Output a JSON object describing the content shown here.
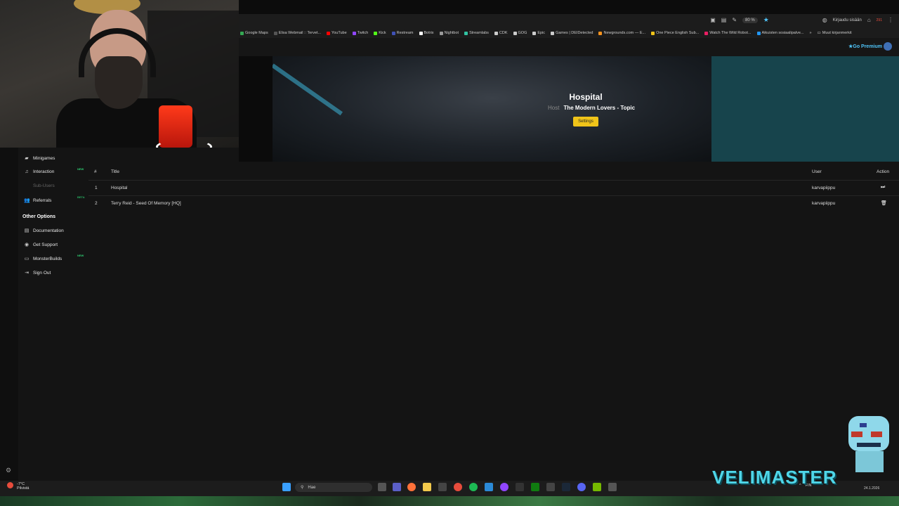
{
  "browser": {
    "zoom": "80 %",
    "profile_label": "Kirjaudu sisään",
    "notif_badge": "291",
    "bookmarks": [
      {
        "label": "Google Maps",
        "color": "#34a853"
      },
      {
        "label": "Elisa Webmail :: Tervet...",
        "color": "#555555"
      },
      {
        "label": "YouTube",
        "color": "#ff0000"
      },
      {
        "label": "Twitch",
        "color": "#9146ff"
      },
      {
        "label": "Kick",
        "color": "#53fc18"
      },
      {
        "label": "Restream",
        "color": "#3f51b5"
      },
      {
        "label": "Botrix",
        "color": "#ffffff"
      },
      {
        "label": "Nightbot",
        "color": "#999999"
      },
      {
        "label": "Streamlabs",
        "color": "#31c3a2"
      },
      {
        "label": "CDK",
        "color": "#cccccc"
      },
      {
        "label": "GOG",
        "color": "#cccccc"
      },
      {
        "label": "Epic",
        "color": "#cccccc"
      },
      {
        "label": "Games | DEIDetected",
        "color": "#cccccc"
      },
      {
        "label": "Newgrounds.com — E...",
        "color": "#f7931e"
      },
      {
        "label": "One Piece English Sub...",
        "color": "#f0c419"
      },
      {
        "label": "Watch The Wild Robot...",
        "color": "#e91e63"
      },
      {
        "label": "Aikuisten sosiaalipalve...",
        "color": "#2196f3"
      }
    ],
    "other_bookmarks": "Muut kirjanmerkit"
  },
  "header": {
    "go_premium": "Go Premium"
  },
  "now_playing": {
    "title": "Hospital",
    "artist_prefix": "Host",
    "artist": "The Modern Lovers - Topic",
    "settings_label": "Settings"
  },
  "sidebar": {
    "items": [
      {
        "label": "Minigames",
        "icon": "gamepad-icon",
        "glyph": "▰"
      },
      {
        "label": "Interaction",
        "icon": "music-icon",
        "glyph": "♫",
        "badge": "NEW"
      },
      {
        "label": "Sub-Users",
        "icon": "users-icon",
        "glyph": "",
        "disabled": true
      },
      {
        "label": "Referrals",
        "icon": "users-icon",
        "glyph": "👥",
        "badge": "BETA"
      }
    ],
    "other_options_heading": "Other Options",
    "other_items": [
      {
        "label": "Documentation",
        "icon": "document-icon",
        "glyph": "▤"
      },
      {
        "label": "Get Support",
        "icon": "support-icon",
        "glyph": "◉"
      },
      {
        "label": "MonsterBuilds",
        "icon": "laptop-icon",
        "glyph": "▭",
        "badge": "NEW"
      },
      {
        "label": "Sign Out",
        "icon": "sign-out-icon",
        "glyph": "⇥"
      }
    ]
  },
  "queue": {
    "columns": {
      "num": "#",
      "title": "Title",
      "user": "User",
      "action": "Action"
    },
    "rows": [
      {
        "num": "1",
        "title": "Hospital",
        "user": "karvapiippu",
        "action_icon": "fast-forward-icon",
        "action_glyph": "⏭"
      },
      {
        "num": "2",
        "title": "Terry Reid - Seed Of Memory [HQ]",
        "user": "karvapiippu",
        "action_icon": "trash-icon",
        "action_glyph": "🗑"
      }
    ]
  },
  "taskbar": {
    "temperature": "-7°C",
    "weather": "Pilvistä",
    "search_placeholder": "Hae",
    "language": "FIN",
    "date": "24.1.2026"
  },
  "overlay": {
    "logo_text": "VELIMASTER"
  },
  "colors": {
    "accent": "#f0c419",
    "premium": "#4fc3f7",
    "background": "#141414"
  }
}
